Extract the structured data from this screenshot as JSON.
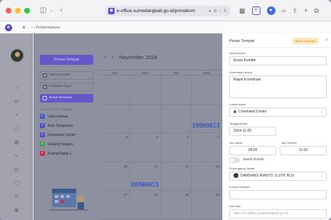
{
  "browser": {
    "url": "e-office.sumedangkab.go.id/primakom",
    "url_lock": "â",
    "icons": [
      "sidebar-toggle-icon",
      "chevron-down-icon",
      "back-icon"
    ]
  },
  "app": {
    "breadcrumb": "⌂ / Pemberitahuan"
  },
  "left_panel": {
    "pesan_button": "Pesan Tempat",
    "menu": [
      {
        "label": "Semua Acara",
        "active": false
      },
      {
        "label": "Pesanan Saya",
        "active": false
      },
      {
        "label": "Butuh Disetujui",
        "active": true
      }
    ],
    "filter_title": "LIHAT FILTER TEMPAT",
    "filters": [
      {
        "label": "Lihat Semua",
        "color": "#4a55c9"
      },
      {
        "label": "Aula Tampomas",
        "color": "#4a55c9"
      },
      {
        "label": "Command Center",
        "color": "#4a55c9"
      },
      {
        "label": "Gedung Negara",
        "color": "#3aa55a"
      },
      {
        "label": "Ruang Rapat 1",
        "color": "#c9304a"
      }
    ]
  },
  "calendar": {
    "month": "November 2024",
    "weekdays": [
      "Sun",
      "Mon",
      "Tue",
      "Wed"
    ],
    "rows": [
      [
        "",
        "",
        "",
        ""
      ],
      [
        "",
        "",
        "",
        ""
      ],
      [
        "3",
        "4",
        "5",
        "6"
      ],
      [
        "10",
        "11",
        "12",
        "13"
      ],
      [
        "17",
        "18",
        "19",
        "20"
      ]
    ],
    "events": [
      "9:00 Rapat Koo",
      "9:00 Rapat Koor",
      "10:00 Rapat Koordi"
    ]
  },
  "drawer": {
    "title": "Pesan Tempat",
    "status_badge": "Belum Disetujui",
    "close": "×",
    "fields": {
      "nama_acara_label": "Nama Acara",
      "nama_acara": "Acara Komitte",
      "keterangan_label": "Keterangan Acara",
      "keterangan": "Rapat Koordinasi",
      "lokasi_label": "Lokasi Acara",
      "lokasi": "Command Center",
      "tanggal_label": "Tanggal Acara",
      "tanggal": "2024-11-05",
      "jam_mulai_label": "Jam Mulai",
      "jam_mulai": "09.00",
      "jam_selesai_label": "Jam Selesai",
      "jam_selesai": "11.00",
      "toggle_label": "Butuh Presdir",
      "pj_label": "Penanggung Jawab",
      "pj": "DAMSANG RIANTO, S.STP, M.Si",
      "kontak_label": "Kontak Sekapen",
      "kontak": "",
      "link_label": "Link Web",
      "link_placeholder": "https://e-office.sumedangkab.go.id"
    }
  }
}
